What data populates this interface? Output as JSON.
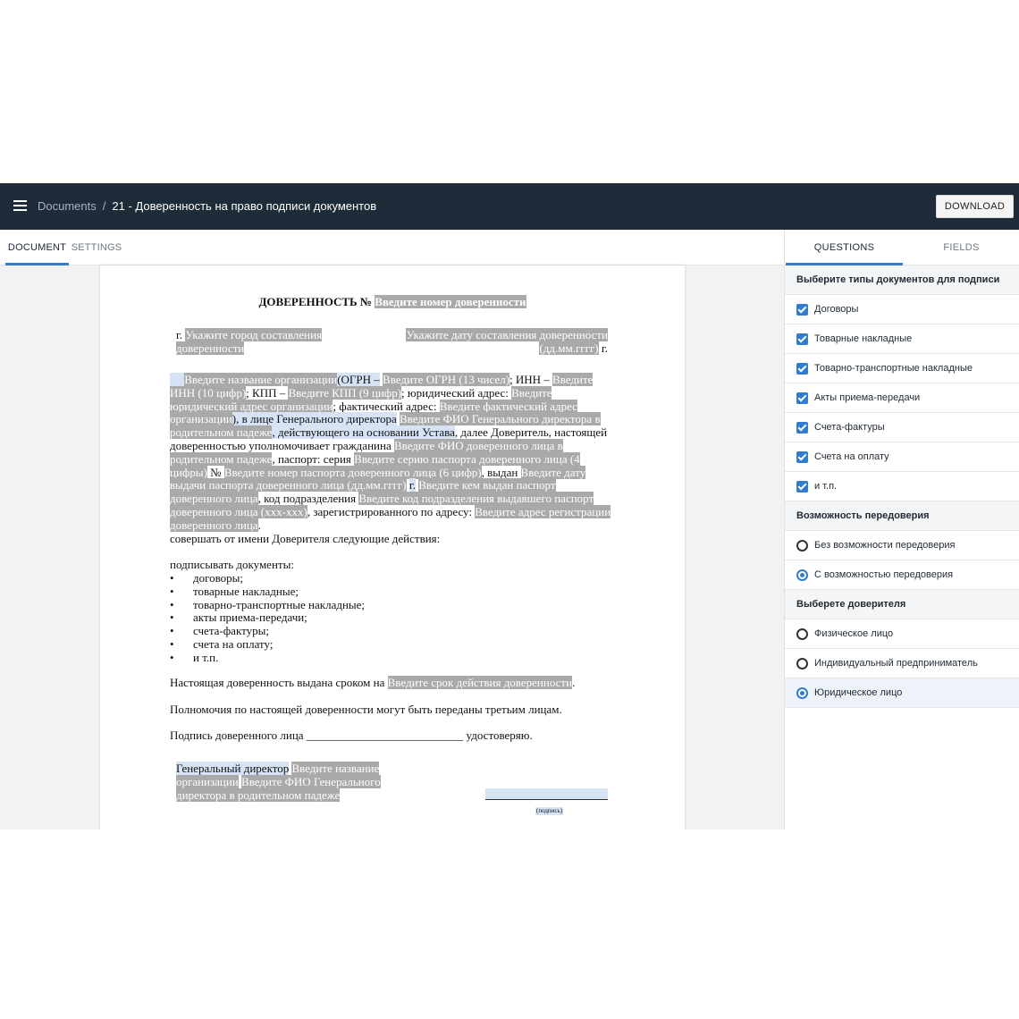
{
  "header": {
    "breadcrumb_root": "Documents",
    "breadcrumb_separator": "/",
    "document_title": "21 - Доверенность на право подписи документов",
    "download_label": "DOWNLOAD",
    "menu_icon": "menu-icon",
    "background_color": "#1e2b39"
  },
  "left_tabs": [
    {
      "label": "DOCUMENT",
      "active": true
    },
    {
      "label": "SETTINGS",
      "active": false
    }
  ],
  "document": {
    "title_prefix": "ДОВЕРЕННОСТЬ №",
    "ph_number": "Введите номер доверенности",
    "city_prefix": "г.",
    "ph_city": "Укажите город составления доверенности",
    "ph_date": "Укажите дату составления доверенности (дд.мм.гггг)",
    "date_suffix": "г.",
    "ph_org": "Введите название организации",
    "t_ogrn": "(ОГРН –",
    "ph_ogrn": "Введите ОГРН (13 чисел)",
    "t_inn": "; ИНН –",
    "ph_inn": "Введите ИНН (10 цифр)",
    "t_kpp": "; КПП –",
    "ph_kpp": "Введите КПП (9 цифр)",
    "t_legal": "; юридический адрес:",
    "ph_legal": "Введите юридический адрес организации",
    "t_actual": "; фактический адрес:",
    "ph_actual": "Введите фактический адрес организации",
    "t_director": "), в лице Генерального директора",
    "ph_director": "Введите ФИО Генерального директора в родительном падеже",
    "t_charter": ", действующего на основании Устава",
    "t_principal": ", далее Доверитель, настоящей доверенностью уполномочивает гражданина",
    "ph_agent": "Введите ФИО доверенного лица в родительном падеже",
    "t_passport": ", паспорт: серия",
    "ph_series": "Введите серию паспорта доверенного лица (4 цифры)",
    "t_no": "№",
    "ph_passport_no": "Введите номер паспорта доверенного лица (6 цифр)",
    "t_issued": ", выдан",
    "ph_issue_date": "Введите дату выдачи паспорта доверенного лица (дд.мм.гггг)",
    "t_year": "г.",
    "ph_issuer": "Введите кем выдан паспорт доверенного лица",
    "t_code": ", код подразделения",
    "ph_code": "Введите код подразделения выдавшего паспорт доверенного лица (ххх-ххх)",
    "t_registered": ", зарегистрированного по адресу:",
    "ph_address": "Введите адрес регистрации доверенного лица",
    "t_period": ".",
    "actions_text": "совершать от имени Доверителя следующие действия:",
    "sign_docs": "подписывать документы:",
    "list": [
      "договоры;",
      "товарные накладные;",
      "товарно-транспортные накладные;",
      "акты приема-передачи;",
      "счета-фактуры;",
      "счета на оплату;",
      "и т.п."
    ],
    "term_text": "Настоящая доверенность выдана сроком на",
    "ph_term": "Введите срок действия доверенности",
    "term_end": ".",
    "delegation_text": "Полномочия по настоящей доверенности могут быть переданы третьим лицам.",
    "signature_text": "Подпись доверенного лица ___________________________ удостоверяю.",
    "sign_director_label": "Генеральный директор",
    "ph_sign_org": "Введите название организации",
    "ph_sign_director": "Введите ФИО Генерального директора в родительном падеже",
    "sig_caption": "(подпись)"
  },
  "right_tabs": [
    {
      "label": "QUESTIONS",
      "active": true
    },
    {
      "label": "FIELDS",
      "active": false
    }
  ],
  "questions": {
    "doc_types_title": "Выберите типы документов для подписи",
    "doc_types": [
      {
        "label": "Договоры",
        "checked": true
      },
      {
        "label": "Товарные накладные",
        "checked": true
      },
      {
        "label": "Товарно-транспортные накладные",
        "checked": true
      },
      {
        "label": "Акты приема-передачи",
        "checked": true
      },
      {
        "label": "Счета-фактуры",
        "checked": true
      },
      {
        "label": "Счета на оплату",
        "checked": true
      },
      {
        "label": "и т.п.",
        "checked": true
      }
    ],
    "redelegation_title": "Возможность передоверия",
    "redelegation": [
      {
        "label": "Без возможности передоверия",
        "selected": false
      },
      {
        "label": "С возможностью передоверия",
        "selected": true
      }
    ],
    "principal_title": "Выберете доверителя",
    "principal": [
      {
        "label": "Физическое лицо",
        "selected": false
      },
      {
        "label": "Индивидуальный предприниматель",
        "selected": false
      },
      {
        "label": "Юридическое лицо",
        "selected": true
      }
    ]
  },
  "colors": {
    "accent": "#2f7cd0",
    "placeholder_bg": "#a9a9a9",
    "highlight_bg": "#d6e3f5"
  }
}
